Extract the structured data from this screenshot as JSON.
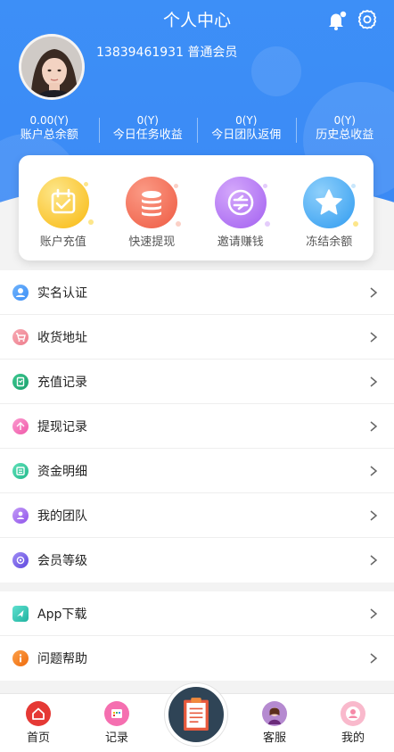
{
  "header": {
    "title": "个人中心",
    "phone_level": "13839461931 普通会员"
  },
  "stats": [
    {
      "value": "0.00(Y)",
      "label": "账户总余额"
    },
    {
      "value": "0(Y)",
      "label": "今日任务收益"
    },
    {
      "value": "0(Y)",
      "label": "今日团队返佣"
    },
    {
      "value": "0(Y)",
      "label": "历史总收益"
    }
  ],
  "quick_actions": [
    {
      "label": "账户充值",
      "icon": "calendar-check-icon",
      "color": "#fbbf24"
    },
    {
      "label": "快速提现",
      "icon": "coin-stack-icon",
      "color": "#f26a4f"
    },
    {
      "label": "邀请赚钱",
      "icon": "invite-badge-icon",
      "color": "#b46ff0"
    },
    {
      "label": "冻结余额",
      "icon": "star-icon",
      "color": "#3aa7f3"
    }
  ],
  "menu_group1": [
    {
      "label": "实名认证",
      "icon": "user-verify-icon",
      "color": "#3d8ff7"
    },
    {
      "label": "收货地址",
      "icon": "shopping-cart-icon",
      "color": "#f08a97"
    },
    {
      "label": "充值记录",
      "icon": "recharge-record-icon",
      "color": "#22b07d"
    },
    {
      "label": "提现记录",
      "icon": "withdraw-record-icon",
      "color": "#f36bb2"
    },
    {
      "label": "资金明细",
      "icon": "fund-detail-icon",
      "color": "#33c9a0"
    },
    {
      "label": "我的团队",
      "icon": "team-icon",
      "color": "#a26bef"
    },
    {
      "label": "会员等级",
      "icon": "member-level-icon",
      "color": "#7a63e8"
    }
  ],
  "menu_group2": [
    {
      "label": "App下载",
      "icon": "download-icon",
      "color": "#2fc1b0"
    },
    {
      "label": "问题帮助",
      "icon": "help-info-icon",
      "color": "#f57c19"
    }
  ],
  "tabs": [
    {
      "label": "首页",
      "icon": "home-icon",
      "color": "#e63d3a"
    },
    {
      "label": "记录",
      "icon": "record-icon",
      "color": "#f56fb0"
    },
    {
      "label": "客服",
      "icon": "customer-service-icon",
      "color": "#8e4fb8"
    },
    {
      "label": "我的",
      "icon": "profile-icon",
      "color": "#f58aa8"
    }
  ]
}
